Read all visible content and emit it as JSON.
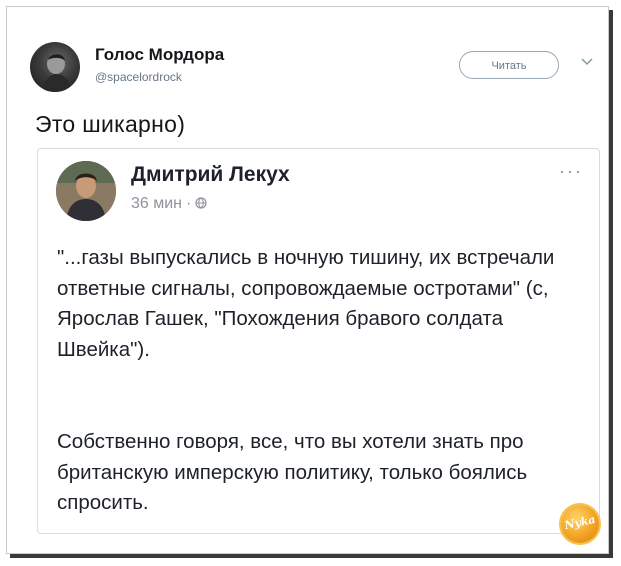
{
  "tweet": {
    "author_name": "Голос Мордора",
    "author_handle": "@spacelordrock",
    "follow_label": "Читать",
    "text": "Это шикарно)"
  },
  "post": {
    "author_name": "Дмитрий Лекух",
    "time": "36 мин",
    "separator": "·",
    "more": "···",
    "paragraph1": "\"...газы выпускались в ночную тишину, их встречали ответные сигналы, сопровождаемые остротами\" (с, Ярослав Гашек, \"Похождения бравого солдата Швейка\").",
    "paragraph2": "Собственно говоря, все, что вы хотели знать про британскую имперскую политику, только боялись спросить."
  },
  "watermark": {
    "text": "Nyka"
  },
  "colors": {
    "handle_gray": "#657786",
    "text_dark": "#14171a",
    "fb_meta_gray": "#90949c",
    "card_border": "#d6dde3"
  }
}
